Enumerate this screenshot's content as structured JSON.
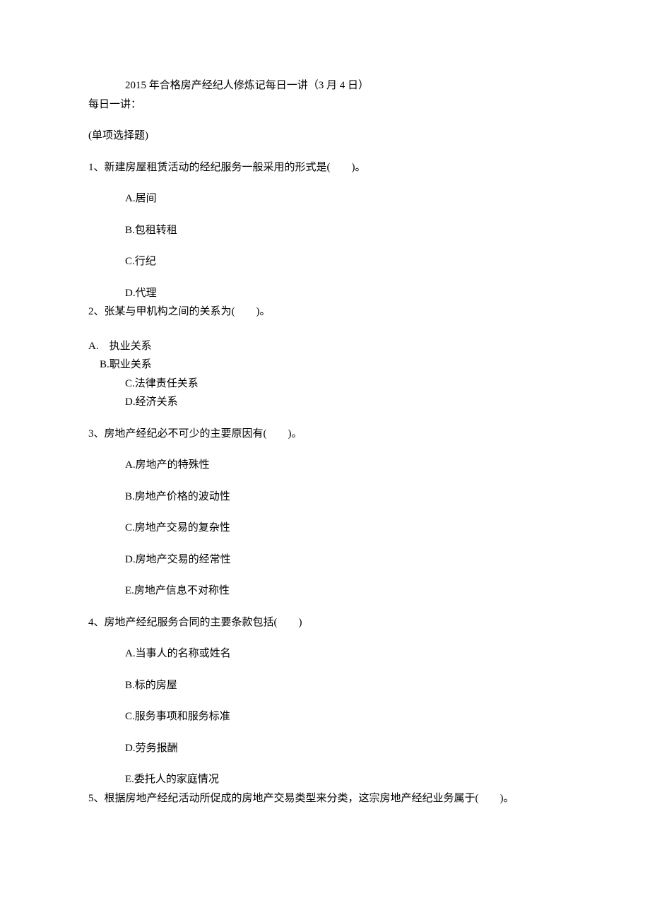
{
  "title": "2015 年合格房产经纪人修炼记每日一讲（3 月 4 日）",
  "subtitle": "每日一讲：",
  "section_label": "(单项选择题)",
  "q1": {
    "stem": "1、新建房屋租赁活动的经纪服务一般采用的形式是(　　)。",
    "a": "A.居间",
    "b": "B.包租转租",
    "c": "C.行纪",
    "d": "D.代理"
  },
  "q2": {
    "stem": "2、张某与甲机构之间的关系为(　　)。",
    "a": "A.　执业关系",
    "b": "B.职业关系",
    "c": "C.法律责任关系",
    "d": "D.经济关系"
  },
  "q3": {
    "stem": "3、房地产经纪必不可少的主要原因有(　　)。",
    "a": "A.房地产的特殊性",
    "b": "B.房地产价格的波动性",
    "c": "C.房地产交易的复杂性",
    "d": "D.房地产交易的经常性",
    "e": "E.房地产信息不对称性"
  },
  "q4": {
    "stem": "4、房地产经纪服务合同的主要条款包括(　　)",
    "a": "A.当事人的名称或姓名",
    "b": "B.标的房屋",
    "c": "C.服务事项和服务标准",
    "d": "D.劳务报酬",
    "e": "E.委托人的家庭情况"
  },
  "q5": {
    "stem": "5、根据房地产经纪活动所促成的房地产交易类型来分类，这宗房地产经纪业务属于(　　)。"
  }
}
